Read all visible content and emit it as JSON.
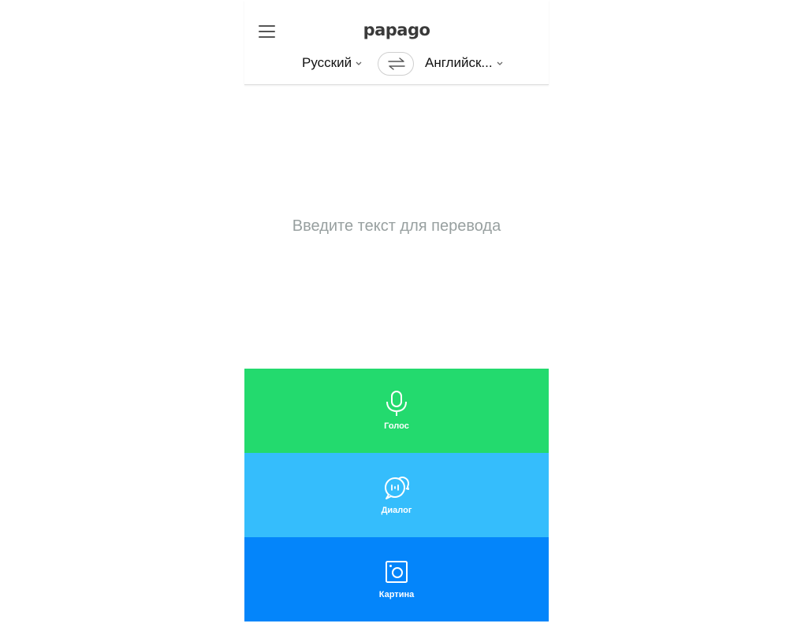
{
  "header": {
    "logo_text": "papago",
    "menu_icon": "hamburger-menu-icon",
    "source_language": "Русский",
    "target_language": "Английск...",
    "swap_icon": "swap-arrows-icon"
  },
  "input": {
    "placeholder": "Введите текст для перевода"
  },
  "modes": {
    "voice": {
      "label": "Голос",
      "icon": "microphone-icon",
      "color": "#23da6e"
    },
    "dialog": {
      "label": "Диалог",
      "icon": "chat-bubbles-icon",
      "color": "#35bdfc"
    },
    "image": {
      "label": "Картина",
      "icon": "camera-icon",
      "color": "#0485fa"
    }
  }
}
